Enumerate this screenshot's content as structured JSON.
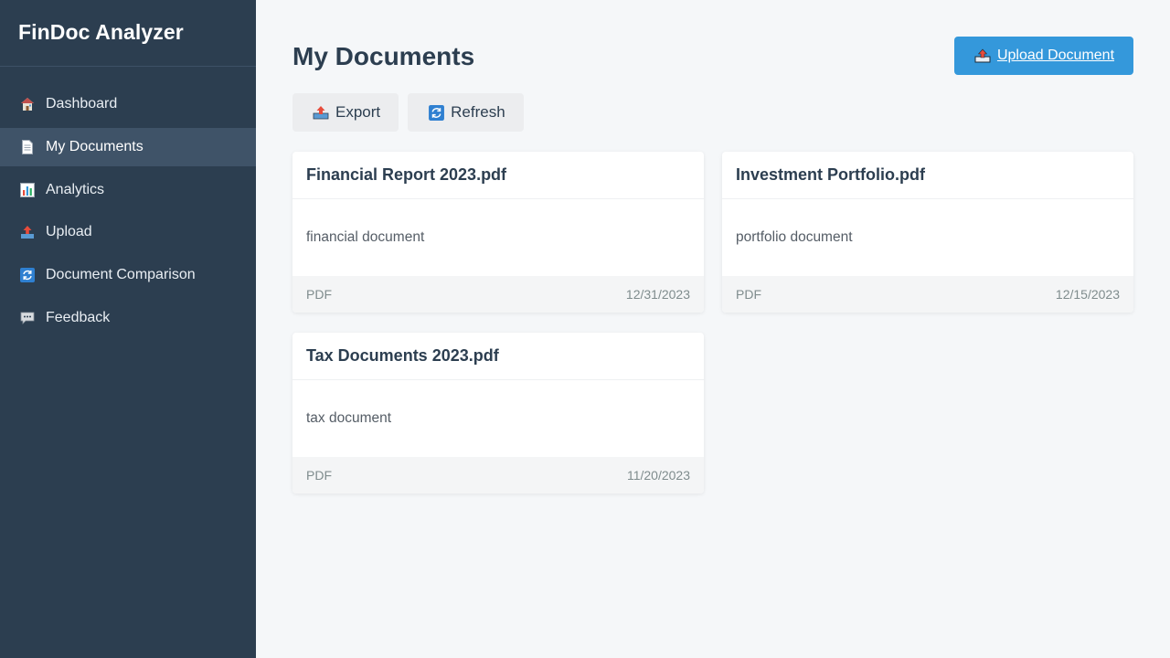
{
  "app": {
    "title": "FinDoc Analyzer"
  },
  "sidebar": {
    "items": [
      {
        "label": "Dashboard",
        "icon": "house-icon",
        "active": false
      },
      {
        "label": "My Documents",
        "icon": "document-icon",
        "active": true
      },
      {
        "label": "Analytics",
        "icon": "bar-chart-icon",
        "active": false
      },
      {
        "label": "Upload",
        "icon": "upload-tray-icon",
        "active": false
      },
      {
        "label": "Document Comparison",
        "icon": "refresh-icon",
        "active": false
      },
      {
        "label": "Feedback",
        "icon": "speech-bubble-icon",
        "active": false
      }
    ]
  },
  "main": {
    "title": "My Documents",
    "upload_label": "Upload Document",
    "toolbar": {
      "export_label": "Export",
      "refresh_label": "Refresh"
    },
    "documents": [
      {
        "name": "Financial Report 2023.pdf",
        "description": "financial document",
        "type": "PDF",
        "date": "12/31/2023"
      },
      {
        "name": "Investment Portfolio.pdf",
        "description": "portfolio document",
        "type": "PDF",
        "date": "12/15/2023"
      },
      {
        "name": "Tax Documents 2023.pdf",
        "description": "tax document",
        "type": "PDF",
        "date": "11/20/2023"
      }
    ]
  },
  "colors": {
    "sidebar_bg": "#2c3e50",
    "accent": "#3498db",
    "page_bg": "#f5f7f9"
  }
}
